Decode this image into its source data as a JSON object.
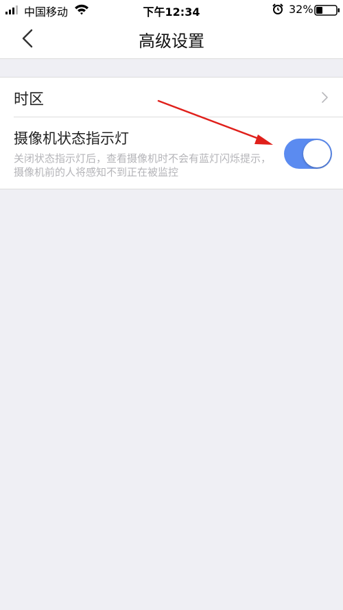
{
  "status_bar": {
    "carrier": "中国移动",
    "time": "下午12:34",
    "battery_percent": "32%",
    "battery_level": 0.32
  },
  "nav": {
    "title": "高级设置",
    "back_icon": "chevron-left-icon"
  },
  "settings": {
    "timezone": {
      "label": "时区",
      "icon": "chevron-right-icon"
    },
    "camera_indicator": {
      "title": "摄像机状态指示灯",
      "description": "关闭状态指示灯后，查看摄像机时不会有蓝灯闪烁提示，摄像机前的人将感知不到正在被监控",
      "enabled": true,
      "toggle_color": "#5b8bf0"
    }
  },
  "annotation": {
    "arrow_color": "#e0201b"
  }
}
